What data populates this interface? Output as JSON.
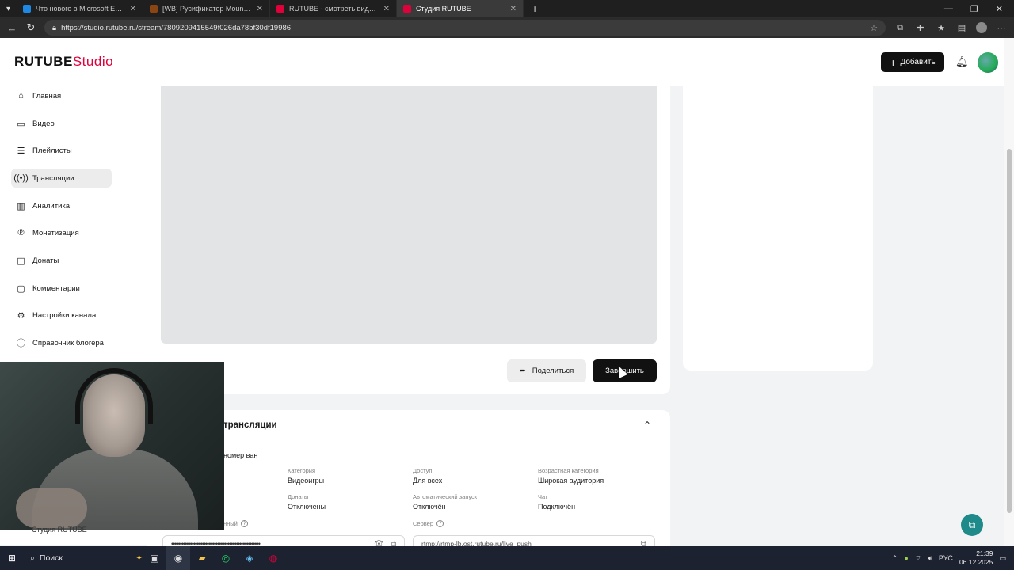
{
  "browser": {
    "tabs": [
      {
        "title": "Что нового в Microsoft Edge",
        "color": "#1e88e5",
        "active": false
      },
      {
        "title": "[WB] Русификатор Mount & Blade",
        "color": "#8b4513",
        "active": false
      },
      {
        "title": "RUTUBE - смотреть видео онлайн",
        "color": "#e0003a",
        "active": false
      },
      {
        "title": "Студия RUTUBE",
        "color": "#e0003a",
        "active": true
      }
    ],
    "url": "https://studio.rutube.ru/stream/7809209415549f026da78bf30df19986"
  },
  "header": {
    "logo_main": "RUTUBE",
    "logo_studio": "Studio",
    "add_label": "Добавить"
  },
  "sidebar": {
    "items": [
      {
        "label": "Главная",
        "icon": "home-icon"
      },
      {
        "label": "Видео",
        "icon": "video-icon"
      },
      {
        "label": "Плейлисты",
        "icon": "playlist-icon"
      },
      {
        "label": "Трансляции",
        "icon": "broadcast-icon",
        "active": true
      },
      {
        "label": "Аналитика",
        "icon": "chart-icon"
      },
      {
        "label": "Монетизация",
        "icon": "coin-icon"
      },
      {
        "label": "Донаты",
        "icon": "donate-icon"
      },
      {
        "label": "Комментарии",
        "icon": "comment-icon"
      },
      {
        "label": "Настройки канала",
        "icon": "gear-icon"
      },
      {
        "label": "Справочник блогера",
        "icon": "info-icon"
      }
    ],
    "bottom_partial": "Студия RUTUBE"
  },
  "stream": {
    "share_label": "Поделиться",
    "finish_label": "Завершить"
  },
  "info": {
    "title_partial": "трансляции",
    "subtitle_partial": "номер ван",
    "fields": {
      "category": {
        "label": "Категория",
        "value": "Видеоигры"
      },
      "access": {
        "label": "Доступ",
        "value": "Для всех"
      },
      "age": {
        "label": "Возрастная категория",
        "value": "Широкая аудитория"
      },
      "donations": {
        "label": "Донаты",
        "value": "Отключены"
      },
      "autostart": {
        "label": "Автоматический запуск",
        "value": "Отключён"
      },
      "chat": {
        "label": "Чат",
        "value": "Подключён"
      }
    },
    "key_label_partial": "нный",
    "server_label": "Сервер",
    "key_value": "••••••••••••••••••••••••••••••••••••••••••••••••••••",
    "server_value": "rtmp://rtmp-lb.ost.rutube.ru/live_push"
  },
  "taskbar": {
    "search_label": "Поиск",
    "lang": "РУС",
    "time": "21:39",
    "date": "06.12.2025"
  }
}
